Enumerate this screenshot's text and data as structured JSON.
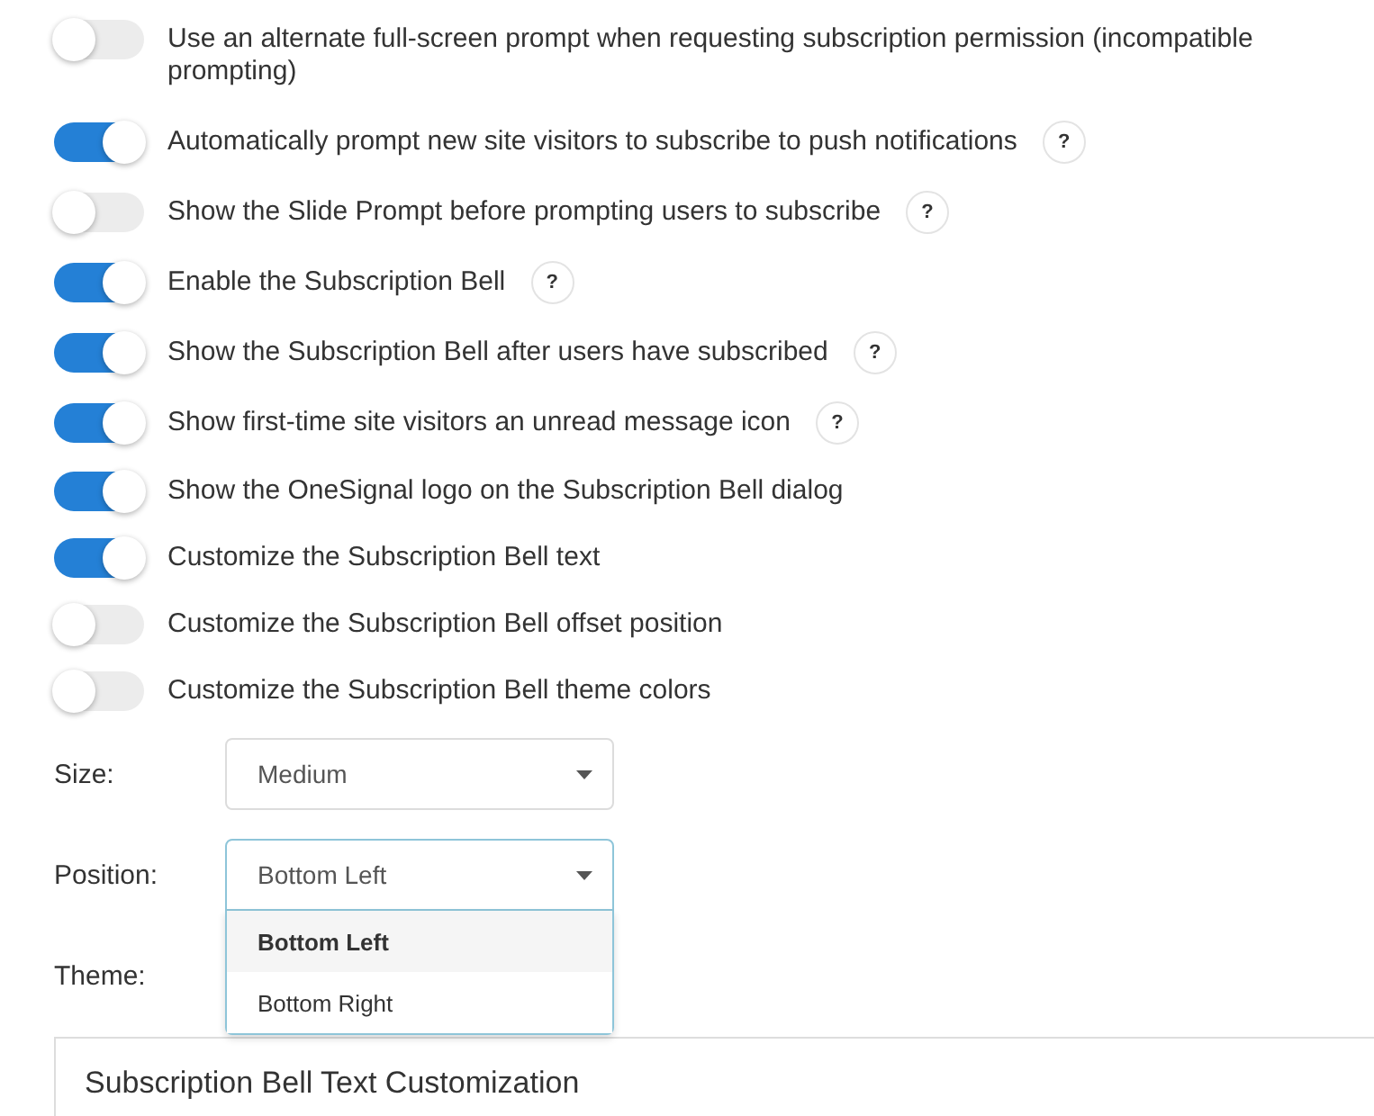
{
  "toggles": [
    {
      "label": "Use an alternate full-screen prompt when requesting subscription permission (incompatible prompting)",
      "on": false
    },
    {
      "label": "Automatically prompt new site visitors to subscribe to push notifications",
      "on": true,
      "help": "?"
    },
    {
      "label": "Show the Slide Prompt before prompting users to subscribe",
      "on": false,
      "help": "?"
    },
    {
      "label": "Enable the Subscription Bell",
      "on": true,
      "help": "?"
    },
    {
      "label": "Show the Subscription Bell after users have subscribed",
      "on": true,
      "help": "?"
    },
    {
      "label": "Show first-time site visitors an unread message icon",
      "on": true,
      "help": "?"
    },
    {
      "label": "Show the OneSignal logo on the Subscription Bell dialog",
      "on": true
    },
    {
      "label": "Customize the Subscription Bell text",
      "on": true
    },
    {
      "label": "Customize the Subscription Bell offset position",
      "on": false
    },
    {
      "label": "Customize the Subscription Bell theme colors",
      "on": false
    }
  ],
  "bell_settings": [
    {
      "label": "Size:",
      "value": "Medium",
      "open": false
    },
    {
      "label": "Position:",
      "value": "Bottom Left",
      "open": true,
      "options": [
        {
          "label": "Bottom Left",
          "selected": true
        },
        {
          "label": "Bottom Right",
          "selected": false
        }
      ]
    },
    {
      "label": "Theme:"
    }
  ],
  "text_customization_panel": {
    "title": "Subscription Bell Text Customization"
  }
}
